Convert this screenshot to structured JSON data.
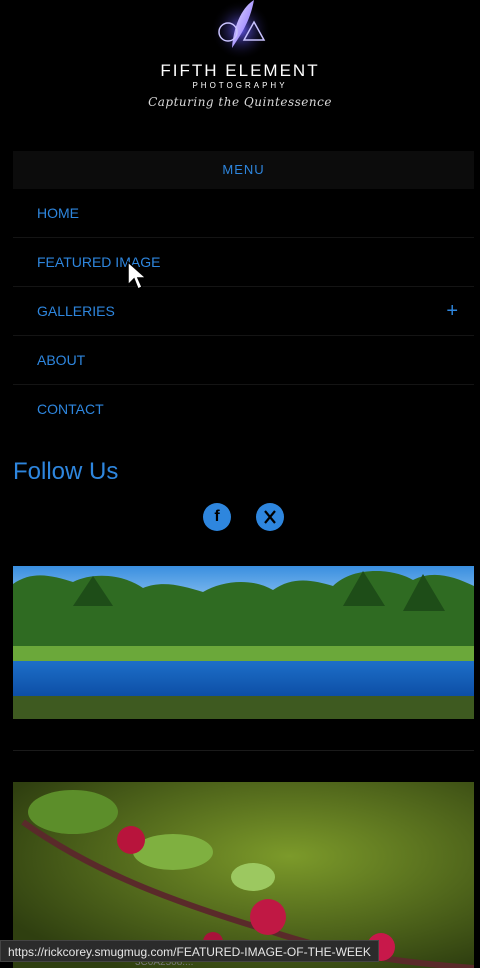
{
  "brand": {
    "title": "FIFTH ELEMENT",
    "subtitle": "PHOTOGRAPHY",
    "tagline": "Capturing the Quintessence"
  },
  "menu": {
    "label": "MENU",
    "items": [
      {
        "label": "HOME"
      },
      {
        "label": "FEATURED IMAGE"
      },
      {
        "label": "GALLERIES",
        "expand": "+"
      },
      {
        "label": "ABOUT"
      },
      {
        "label": "CONTACT"
      }
    ]
  },
  "follow": {
    "heading": "Follow Us",
    "icons": [
      "facebook-icon",
      "x-icon"
    ]
  },
  "status_bar": {
    "url": "https://rickcorey.smugmug.com/FEATURED-IMAGE-OF-THE-WEEK",
    "under_text": "3C0A2508...."
  },
  "colors": {
    "accent": "#2e86de",
    "background": "#000000"
  }
}
